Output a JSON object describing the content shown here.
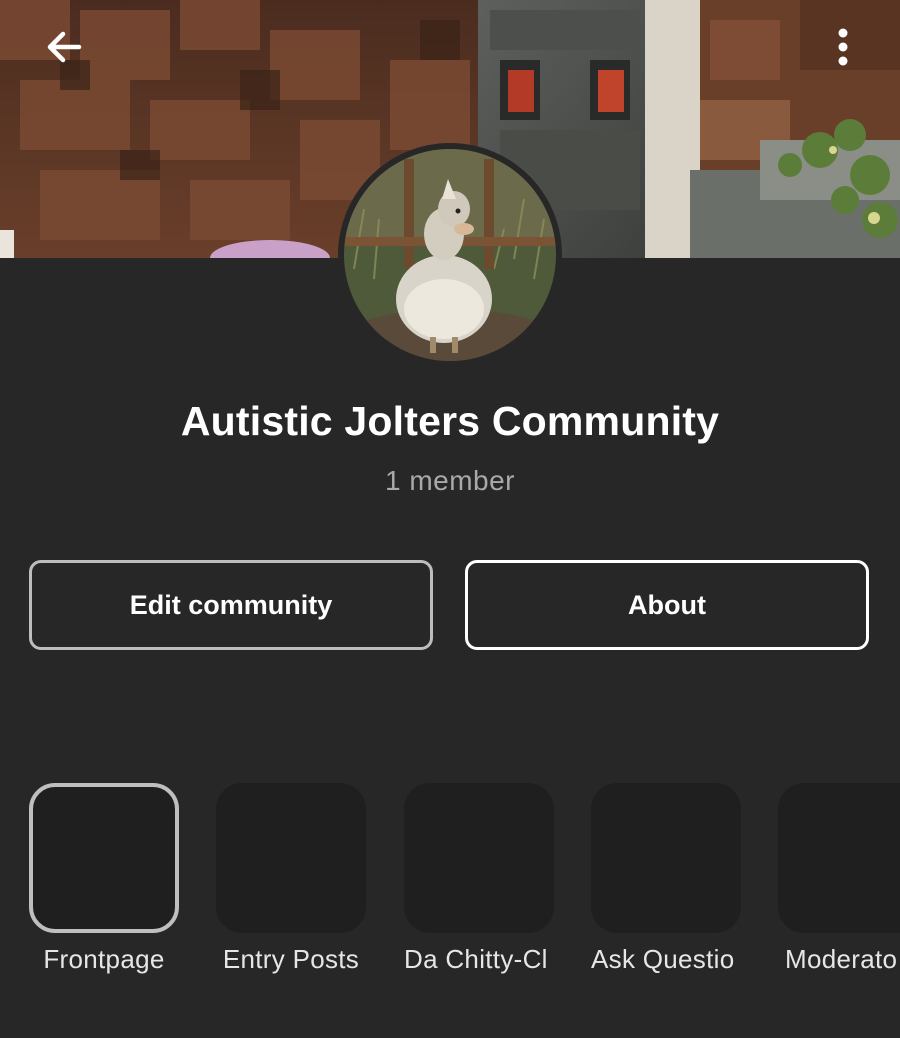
{
  "header": {
    "back_icon": "arrow-left-icon",
    "menu_icon": "more-vertical-icon"
  },
  "community": {
    "name": "Autistic Jolters Community",
    "member_count": "1 member"
  },
  "actions": {
    "edit_label": "Edit community",
    "about_label": "About"
  },
  "channels": [
    {
      "label": "Frontpage",
      "selected": true
    },
    {
      "label": "Entry Posts",
      "selected": false
    },
    {
      "label": "Da Chitty-Cl",
      "selected": false
    },
    {
      "label": "Ask Questio",
      "selected": false
    },
    {
      "label": "Moderato",
      "selected": false
    }
  ],
  "colors": {
    "background": "#272727",
    "tile": "#1f1f1f",
    "text": "#ffffff",
    "muted_text": "#a9a9a9"
  }
}
